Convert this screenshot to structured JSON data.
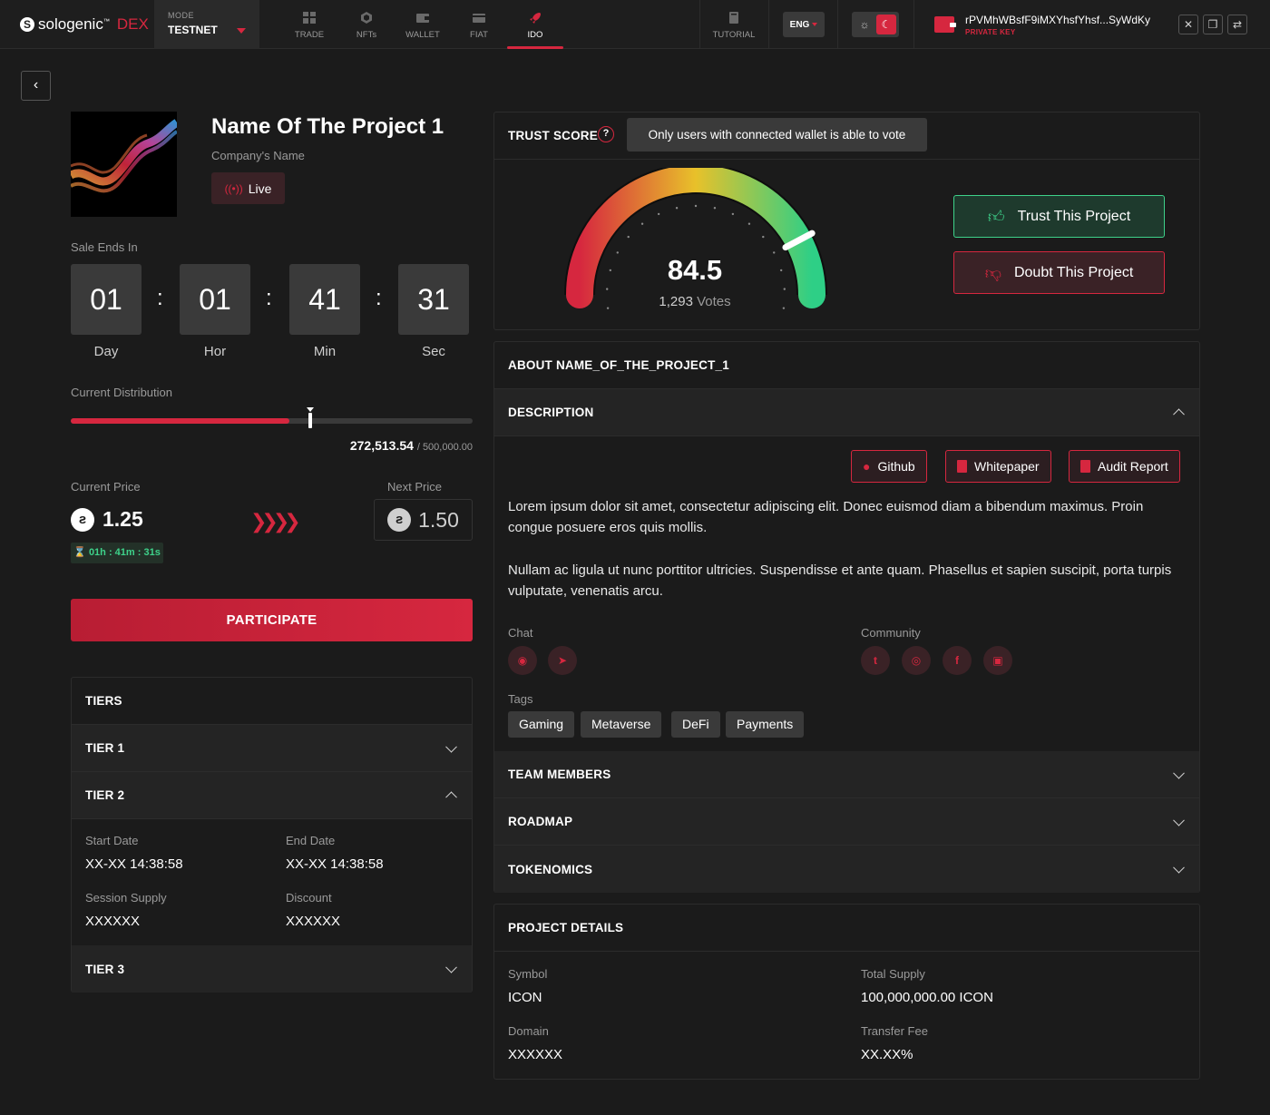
{
  "brand": {
    "name_prefix": "solo",
    "name_suffix": "genic",
    "tm": "™",
    "product": "DEX",
    "mark": "S"
  },
  "mode": {
    "label": "MODE",
    "value": "TESTNET"
  },
  "nav": [
    {
      "label": "TRADE",
      "icon": "grid-icon"
    },
    {
      "label": "NFTs",
      "icon": "hexagon-icon"
    },
    {
      "label": "WALLET",
      "icon": "wallet-icon"
    },
    {
      "label": "FIAT",
      "icon": "card-icon"
    },
    {
      "label": "IDO",
      "icon": "rocket-icon"
    },
    {
      "label": "TUTORIAL",
      "icon": "book-icon"
    }
  ],
  "language": "ENG",
  "wallet": {
    "address": "rPVMhWBsfF9iMXYhsfYhsf...SyWdKy",
    "key_type": "PRIVATE KEY"
  },
  "project": {
    "title": "Name Of The Project 1",
    "company": "Company's Name",
    "status": "Live"
  },
  "sale": {
    "ends_label": "Sale Ends In",
    "countdown": [
      {
        "value": "01",
        "unit": "Day"
      },
      {
        "value": "01",
        "unit": "Hor"
      },
      {
        "value": "41",
        "unit": "Min"
      },
      {
        "value": "31",
        "unit": "Sec"
      }
    ]
  },
  "distribution": {
    "label": "Current Distribution",
    "current": "272,513.54",
    "total": "/ 500,000.00",
    "fraction": 0.545
  },
  "price": {
    "current_label": "Current Price",
    "current": "1.25",
    "next_label": "Next Price",
    "next": "1.50",
    "timer": "01h : 41m : 31s"
  },
  "participate": "PARTICIPATE",
  "tiers": {
    "title": "TIERS",
    "items": [
      {
        "label": "TIER 1",
        "open": false
      },
      {
        "label": "TIER 2",
        "open": true
      },
      {
        "label": "TIER 3",
        "open": false
      }
    ],
    "details": {
      "start_label": "Start Date",
      "start": "XX-XX 14:38:58",
      "end_label": "End Date",
      "end": "XX-XX 14:38:58",
      "supply_label": "Session Supply",
      "supply": "XXXXXX",
      "discount_label": "Discount",
      "discount": "XXXXXX"
    }
  },
  "trust": {
    "title": "TRUST SCORE",
    "tooltip": "Only users with connected wallet is able to vote",
    "score": "84.5",
    "score_value": 84.5,
    "votes": "1,293",
    "votes_label": "Votes",
    "trust_btn": "Trust This Project",
    "doubt_btn": "Doubt This Project"
  },
  "about": {
    "title": "ABOUT NAME_OF_THE_PROJECT_1",
    "description_title": "DESCRIPTION",
    "links": [
      "Github",
      "Whitepaper",
      "Audit Report"
    ],
    "paragraphs": [
      "Lorem ipsum dolor sit amet, consectetur adipiscing elit. Donec euismod diam a bibendum maximus. Proin congue posuere eros quis mollis.",
      "Nullam ac ligula ut nunc porttitor ultricies. Suspendisse et ante quam. Phasellus et sapien suscipit, porta turpis vulputate, venenatis arcu."
    ],
    "chat_label": "Chat",
    "community_label": "Community",
    "tags_label": "Tags",
    "tags": [
      "Gaming",
      "Metaverse",
      "DeFi",
      "Payments"
    ],
    "sections": [
      "TEAM MEMBERS",
      "ROADMAP",
      "TOKENOMICS"
    ]
  },
  "details": {
    "title": "PROJECT DETAILS",
    "symbol_label": "Symbol",
    "symbol": "ICON",
    "supply_label": "Total Supply",
    "supply": "100,000,000.00 ICON",
    "domain_label": "Domain",
    "domain": "XXXXXX",
    "fee_label": "Transfer Fee",
    "fee": "XX.XX%"
  },
  "colors": {
    "accent": "#d6273f",
    "positive": "#3ed28a",
    "bg": "#1b1b1b"
  }
}
